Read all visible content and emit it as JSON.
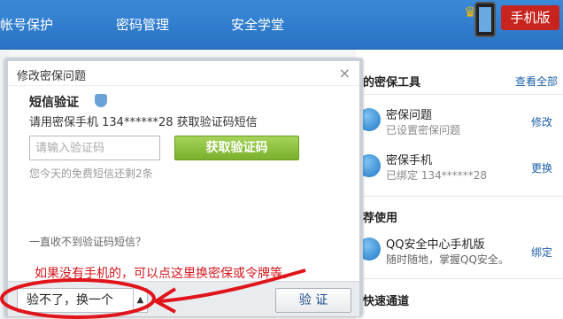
{
  "nav": {
    "items": [
      {
        "label": "帐号保护"
      },
      {
        "label": "密码管理"
      },
      {
        "label": "安全学堂"
      }
    ],
    "promo_label": "手机版"
  },
  "sidebar": {
    "tools_title": "的密保工具",
    "view_all": "查看全部",
    "tools": [
      {
        "name": "密保问题",
        "status": "已设置密保问题",
        "action": "修改",
        "icon": "question-shield-icon"
      },
      {
        "name": "密保手机",
        "status": "已绑定 134******28",
        "action": "更换",
        "icon": "phone-shield-icon"
      }
    ],
    "recommend_title": "荐使用",
    "recommend": {
      "name": "QQ安全中心手机版",
      "desc": "随时随地，掌握QQ安全。",
      "action": "绑定"
    },
    "quick_title": "快速通道"
  },
  "dialog": {
    "title": "修改密保问题",
    "close": "×",
    "sms_title": "短信验证",
    "sms_desc": "请用密保手机 134******28 获取验证码短信",
    "code_placeholder": "请输入验证码",
    "get_code_button": "获取验证码",
    "free_left": "您今天的免费短信还剩2条",
    "no_sms_link": "一直收不到验证码短信？",
    "annotation": "如果没有手机的，可以点这里换密保或令牌等。",
    "switch_button": "验不了，换一个",
    "switch_arrow": "▲",
    "verify_button": "验 证"
  },
  "colors": {
    "nav_bg": "#2f7ccc",
    "green_button": "#8bc13d",
    "annotation_red": "#d4151b",
    "link_blue": "#1d5fa8"
  }
}
